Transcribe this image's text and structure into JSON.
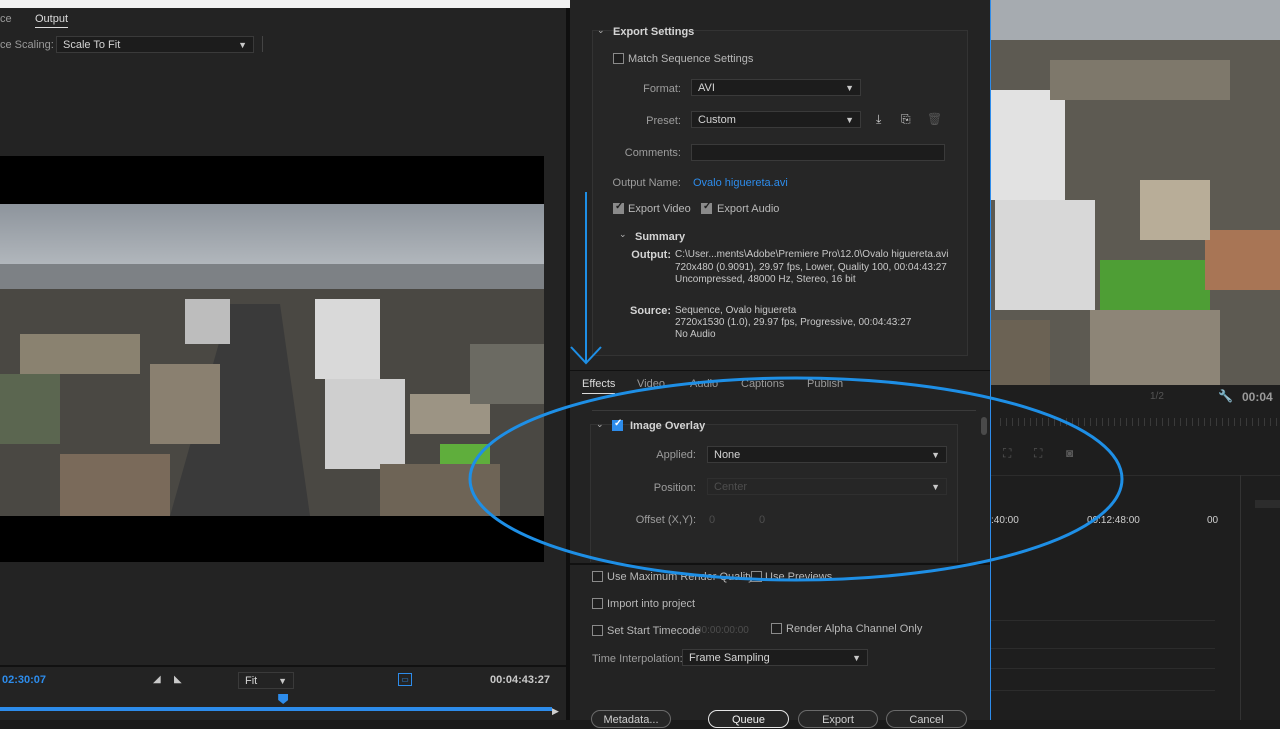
{
  "source_panel": {
    "tabs": [
      "ce",
      "Output"
    ],
    "scaling_label": "ce Scaling:",
    "scaling_value": "Scale To Fit",
    "current_timecode": "02:30:07",
    "fit_value": "Fit",
    "duration": "00:04:43:27",
    "playhead_fraction": 0.513
  },
  "export_settings": {
    "section_title": "Export Settings",
    "match_sequence_label": "Match Sequence Settings",
    "format_label": "Format:",
    "format_value": "AVI",
    "preset_label": "Preset:",
    "preset_value": "Custom",
    "comments_label": "Comments:",
    "comments_value": "",
    "output_name_label": "Output Name:",
    "output_name_value": "Ovalo higuereta.avi",
    "export_video_label": "Export Video",
    "export_audio_label": "Export Audio",
    "summary": {
      "title": "Summary",
      "output_label": "Output:",
      "output_lines": [
        "C:\\User...ments\\Adobe\\Premiere Pro\\12.0\\Ovalo higuereta.avi",
        "720x480 (0.9091), 29.97 fps, Lower, Quality 100, 00:04:43:27",
        "Uncompressed, 48000 Hz, Stereo, 16 bit"
      ],
      "source_label": "Source:",
      "source_lines": [
        "Sequence, Ovalo higuereta",
        "2720x1530 (1.0), 29.97 fps, Progressive, 00:04:43:27",
        "No Audio"
      ]
    }
  },
  "subtabs": [
    "Effects",
    "Video",
    "Audio",
    "Captions",
    "Publish"
  ],
  "image_overlay": {
    "title": "Image Overlay",
    "applied_label": "Applied:",
    "applied_value": "None",
    "position_label": "Position:",
    "position_value": "Center",
    "offset_label": "Offset (X,Y):",
    "offset_x": "0",
    "offset_y": "0"
  },
  "bottom_options": {
    "max_render_quality": "Use Maximum Render Quality",
    "use_previews": "Use Previews",
    "import_into_project": "Import into project",
    "set_start_timecode": "Set Start Timecode",
    "start_timecode_value": "00:00:00:00",
    "render_alpha": "Render Alpha Channel Only",
    "time_interpolation_label": "Time Interpolation:",
    "time_interpolation_value": "Frame Sampling"
  },
  "buttons": {
    "metadata": "Metadata...",
    "queue": "Queue",
    "export": "Export",
    "cancel": "Cancel"
  },
  "right_panel": {
    "resolution": "1/2",
    "timecode_partial": "00:04",
    "ruler_left": ":40:00",
    "ruler_mid": "00:12:48:00",
    "ruler_right": "00"
  },
  "colors": {
    "accent_blue": "#2d8ceb",
    "annotation_blue": "#1e8fe6"
  }
}
